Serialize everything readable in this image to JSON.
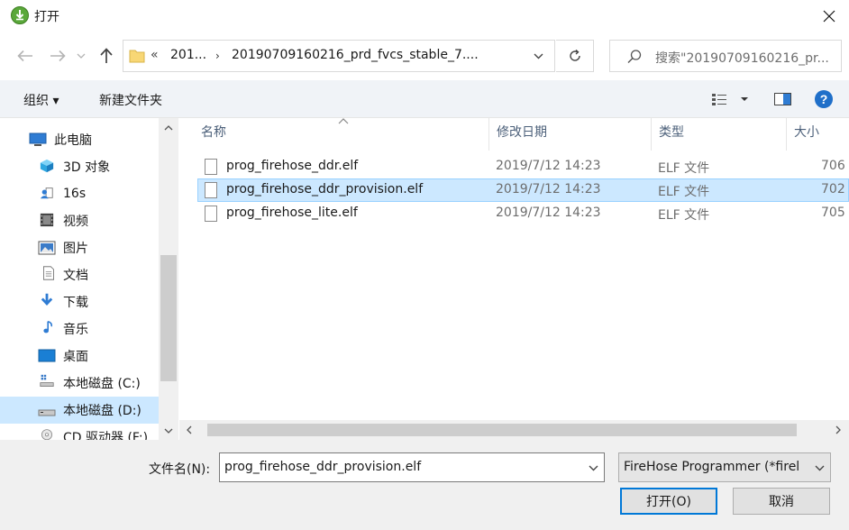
{
  "title_bar": {
    "title": "打开"
  },
  "address_bar": {
    "prefix": "«",
    "crumbs": [
      "201...",
      "20190709160216_prd_fvcs_stable_7...."
    ]
  },
  "search": {
    "placeholder": "搜索\"20190709160216_pr..."
  },
  "toolbar": {
    "organize_label": "组织 ▾",
    "new_folder_label": "新建文件夹"
  },
  "sidebar": {
    "items": [
      {
        "label": "此电脑",
        "icon": "computer-icon"
      },
      {
        "label": "3D 对象",
        "icon": "3d-objects-icon"
      },
      {
        "label": "16s",
        "icon": "user-folder-icon"
      },
      {
        "label": "视频",
        "icon": "video-icon"
      },
      {
        "label": "图片",
        "icon": "pictures-icon"
      },
      {
        "label": "文档",
        "icon": "documents-icon"
      },
      {
        "label": "下载",
        "icon": "download-icon"
      },
      {
        "label": "音乐",
        "icon": "music-icon"
      },
      {
        "label": "桌面",
        "icon": "desktop-icon"
      },
      {
        "label": "本地磁盘 (C:)",
        "icon": "drive-c-icon"
      },
      {
        "label": "本地磁盘 (D:)",
        "icon": "drive-d-icon"
      },
      {
        "label": "CD 驱动器 (F:)",
        "icon": "cd-drive-icon"
      }
    ]
  },
  "file_list": {
    "columns": [
      "名称",
      "修改日期",
      "类型",
      "大小"
    ],
    "rows": [
      {
        "name": "prog_firehose_ddr.elf",
        "date": "2019/7/12 14:23",
        "type": "ELF 文件",
        "size": "706"
      },
      {
        "name": "prog_firehose_ddr_provision.elf",
        "date": "2019/7/12 14:23",
        "type": "ELF 文件",
        "size": "702"
      },
      {
        "name": "prog_firehose_lite.elf",
        "date": "2019/7/12 14:23",
        "type": "ELF 文件",
        "size": "705"
      }
    ]
  },
  "bottom": {
    "filename_label": "文件名(N):",
    "filename_value": "prog_firehose_ddr_provision.elf",
    "filetype_value": "FireHose Programmer (*firel",
    "open_label": "打开(O)",
    "cancel_label": "取消"
  },
  "colors": {
    "accent": "#0078d7",
    "selection": "#cce8ff",
    "help": "#1f6fc9",
    "folder": "#f8d775"
  }
}
